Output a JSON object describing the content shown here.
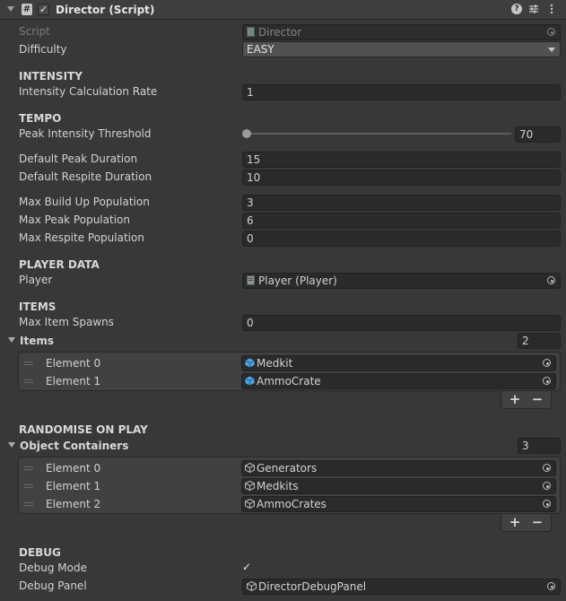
{
  "header": {
    "title": "Director (Script)",
    "enabled": true
  },
  "script": {
    "label": "Script",
    "value": "Director"
  },
  "difficulty": {
    "label": "Difficulty",
    "value": "EASY"
  },
  "intensity": {
    "heading": "INTENSITY",
    "rate_label": "Intensity Calculation Rate",
    "rate_value": "1"
  },
  "tempo": {
    "heading": "TEMPO",
    "peak_threshold_label": "Peak Intensity Threshold",
    "peak_threshold_value": "70",
    "peak_threshold_fraction": 0.0,
    "peak_duration_label": "Default Peak Duration",
    "peak_duration_value": "15",
    "respite_duration_label": "Default Respite Duration",
    "respite_duration_value": "10",
    "buildup_pop_label": "Max Build Up Population",
    "buildup_pop_value": "3",
    "peak_pop_label": "Max Peak Population",
    "peak_pop_value": "6",
    "respite_pop_label": "Max Respite Population",
    "respite_pop_value": "0"
  },
  "player_data": {
    "heading": "PLAYER DATA",
    "player_label": "Player",
    "player_value": "Player (Player)"
  },
  "items": {
    "heading": "ITEMS",
    "max_spawns_label": "Max Item Spawns",
    "max_spawns_value": "0",
    "list_label": "Items",
    "list_size": "2",
    "elements": [
      {
        "label": "Element 0",
        "value": "Medkit"
      },
      {
        "label": "Element 1",
        "value": "AmmoCrate"
      }
    ]
  },
  "randomise": {
    "heading": "RANDOMISE ON PLAY",
    "list_label": "Object Containers",
    "list_size": "3",
    "elements": [
      {
        "label": "Element 0",
        "value": "Generators"
      },
      {
        "label": "Element 1",
        "value": "Medkits"
      },
      {
        "label": "Element 2",
        "value": "AmmoCrates"
      }
    ]
  },
  "debug": {
    "heading": "DEBUG",
    "mode_label": "Debug Mode",
    "mode_checked": true,
    "panel_label": "Debug Panel",
    "panel_value": "DirectorDebugPanel"
  },
  "buttons": {
    "add": "+",
    "remove": "−"
  },
  "icons": [
    "foldout-arrow-icon",
    "script-hash-icon",
    "checkbox-icon",
    "help-icon",
    "presets-icon",
    "menu-icon",
    "script-file-icon",
    "object-picker-icon",
    "gameobject-icon",
    "prefab-cube-icon",
    "drag-handle-icon",
    "plus-icon",
    "minus-icon",
    "checkmark-icon"
  ],
  "colors": {
    "background": "#383838",
    "field": "#2a2a2a",
    "prefab_blue": "#4aa8e8",
    "text": "#d2d2d2"
  }
}
